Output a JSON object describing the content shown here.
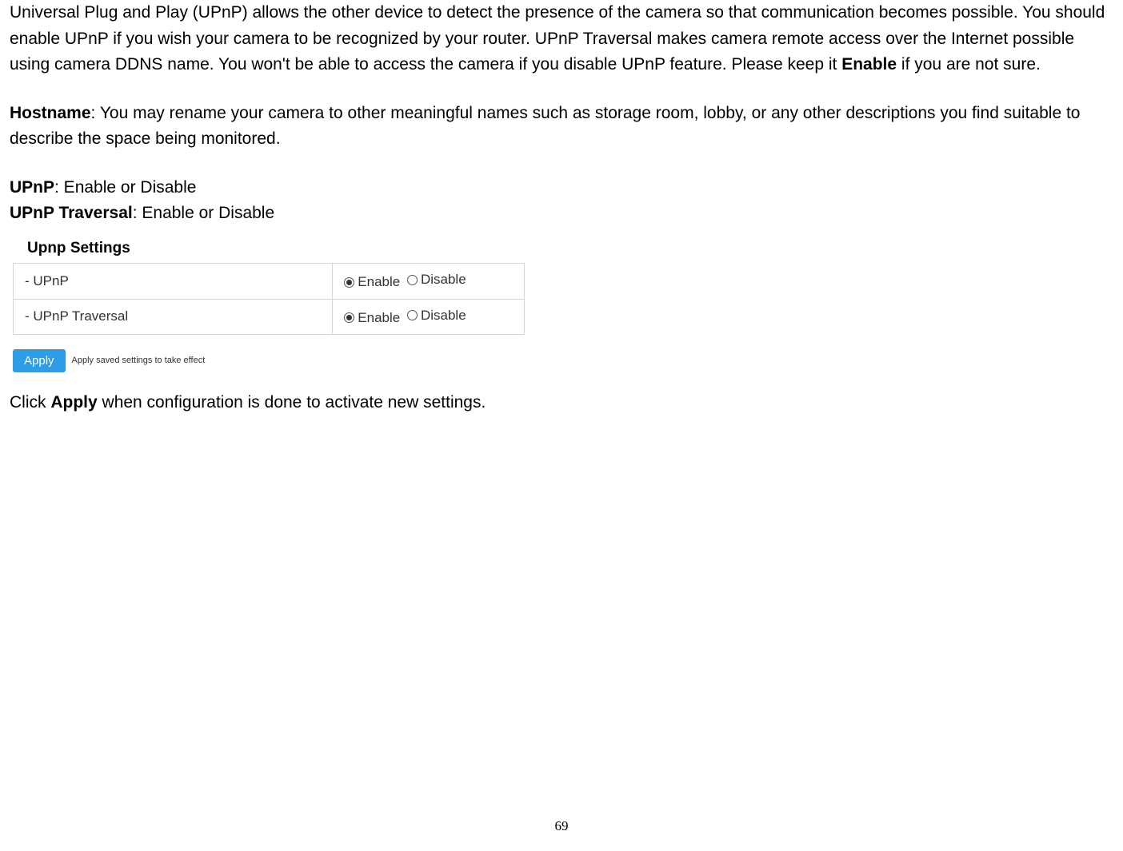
{
  "intro": {
    "text_a": "Universal Plug and Play   (UPnP) allows the other device to detect the presence of the camera so that communication becomes possible. You should enable UPnP if you wish your camera to be recognized by your router. UPnP Traversal makes camera remote access over the Internet possible using camera DDNS name. You won't be able to access the camera if you disable UPnP feature. Please keep it ",
    "bold_enable": "Enable",
    "text_b": " if you are not sure."
  },
  "hostname": {
    "label": "Hostname",
    "text": ": You may rename your camera to other meaningful names such as storage room, lobby, or any other descriptions you find suitable to describe the space being monitored."
  },
  "upnp_line": {
    "label": "UPnP",
    "text": ": Enable or Disable"
  },
  "upnp_traversal_line": {
    "label": "UPnP Traversal",
    "text": ": Enable or Disable"
  },
  "panel": {
    "title": "Upnp Settings",
    "rows": [
      {
        "label": "- UPnP",
        "enable": "Enable",
        "disable": "Disable",
        "selected": "enable"
      },
      {
        "label": "- UPnP Traversal",
        "enable": "Enable",
        "disable": "Disable",
        "selected": "enable"
      }
    ],
    "apply_label": "Apply",
    "apply_hint": "Apply saved settings to take effect"
  },
  "closing": {
    "text_a": "Click ",
    "bold_apply": "Apply",
    "text_b": " when configuration is done to activate new settings."
  },
  "page_number": "69"
}
